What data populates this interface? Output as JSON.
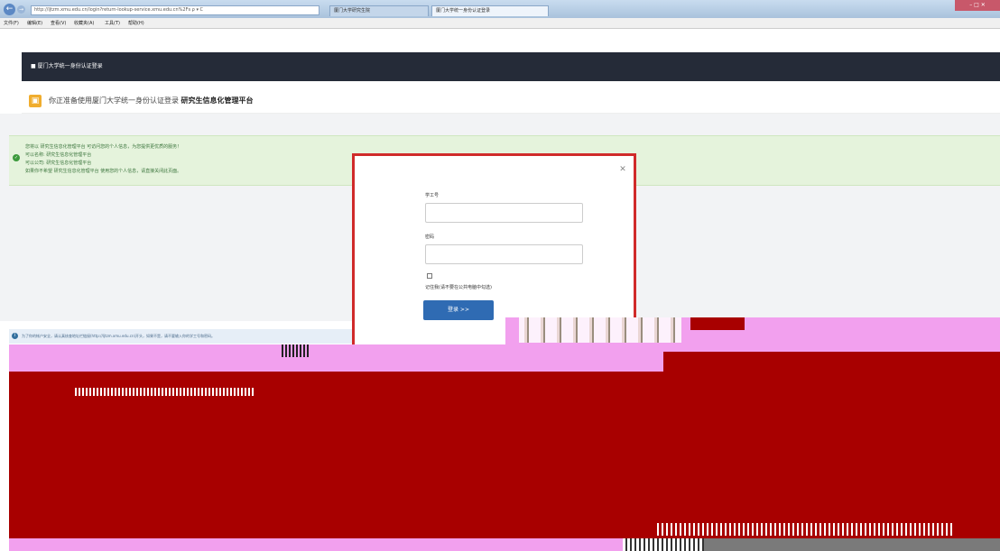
{
  "browser": {
    "address": "http://ljtzm.xmu.edu.cn/login?return-lookup-service.xmu.edu.cn%2Fs ρ ▾ C",
    "tabs": [
      "厦门大学研究生院",
      "厦门大学统一身份认证登录"
    ],
    "menu": [
      "文件(F)",
      "编辑(E)",
      "查看(V)",
      "收藏夹(A)",
      "工具(T)",
      "帮助(H)"
    ]
  },
  "page": {
    "header_title": "厦门大学统一身份认证登录",
    "notice_prefix": "你正准备使用厦门大学统一身份认证登录",
    "notice_strong": "研究生信息化管理平台",
    "success_lines": [
      "您将以 研究生信息化管理平台 可访问您的个人信息，为您提供更优质的服务！",
      "可以名称: 研究生信息化管理平台",
      "可以公司: 研究生信息化管理平台",
      "如果你不希望 研究生信息化管理平台 使用您的个人信息，请直接关闭此页面。"
    ],
    "info_text": "为了你的帐户安全，请认真核查地址栏链接(http://ljtzm.xmu.edu.cn)开头，如果不是，请不要输入你的学工号和密码。"
  },
  "login": {
    "username_label": "学工号",
    "password_label": "密码",
    "remember_label": "记住我(请不要在公共电脑中勾选)",
    "login_button": "登录 >>"
  },
  "colors": {
    "glitch_red": "#a80000",
    "glitch_pink": "#f2a0ee",
    "frame_red": "#d02a2a",
    "button_blue": "#2f6bb3"
  }
}
